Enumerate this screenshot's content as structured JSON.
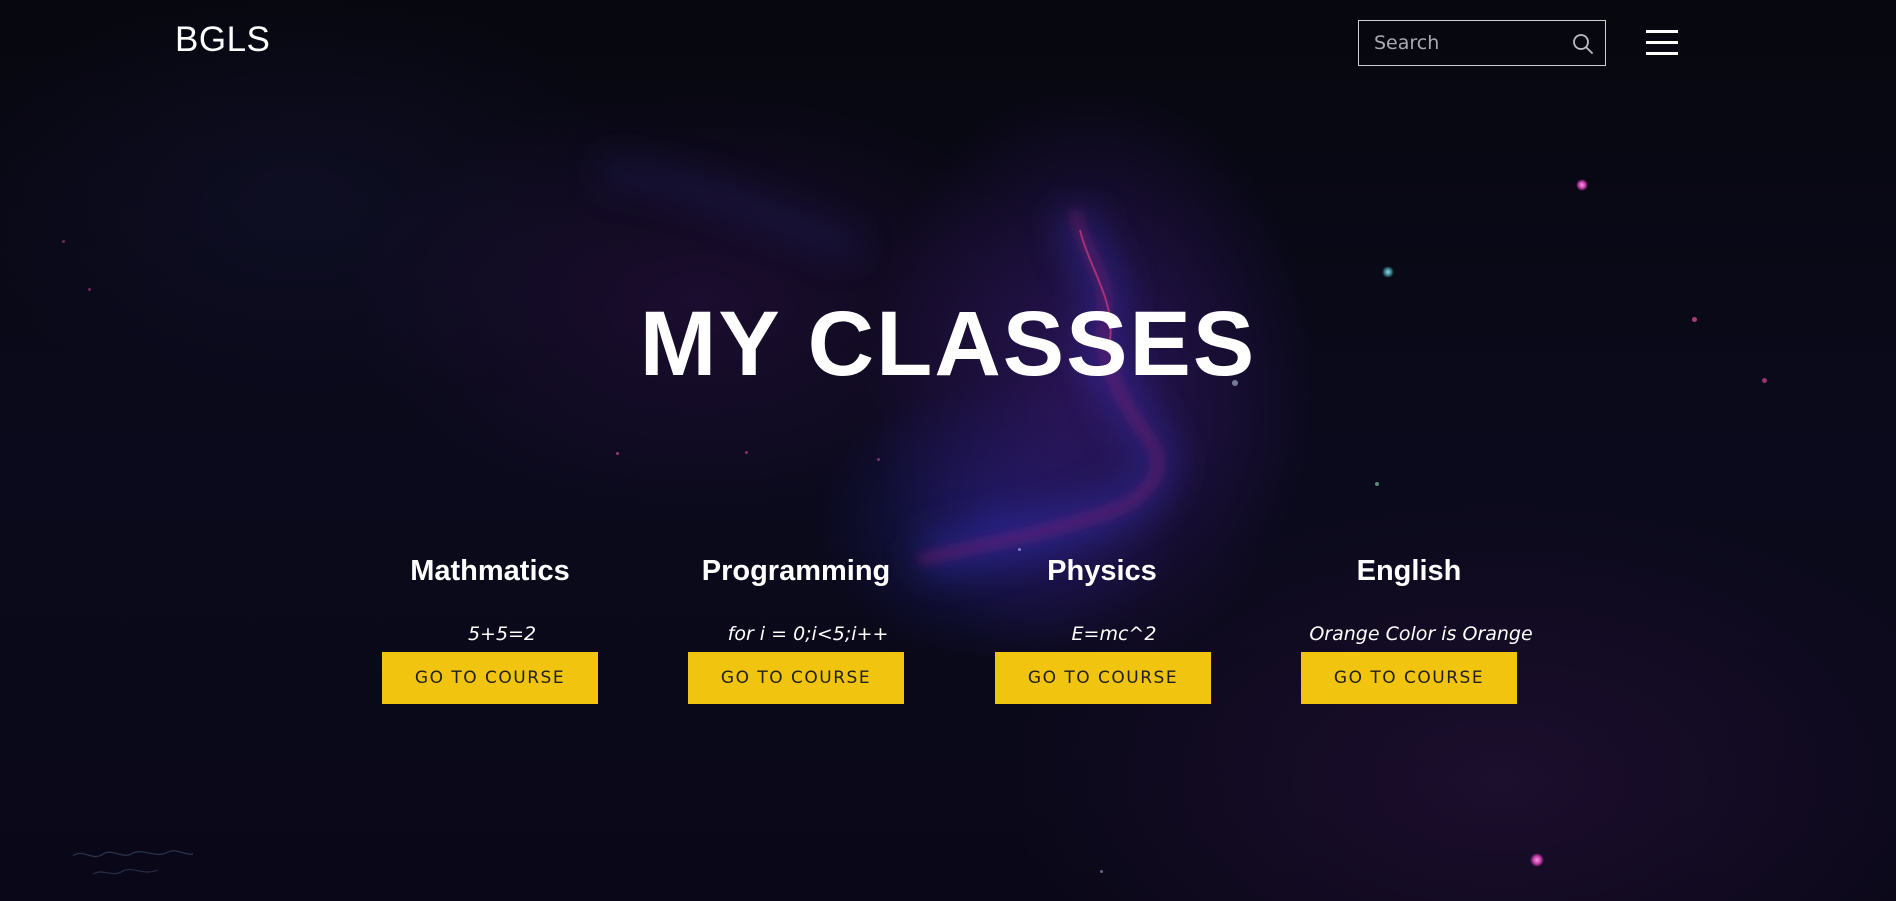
{
  "header": {
    "brand": "BGLS",
    "search": {
      "placeholder": "Search",
      "value": ""
    },
    "icons": {
      "search": "search-icon",
      "menu": "hamburger-menu-icon"
    }
  },
  "hero": {
    "title": "MY CLASSES"
  },
  "courses": [
    {
      "title": "Mathmatics",
      "description": "5+5=2",
      "button_label": "GO TO COURSE"
    },
    {
      "title": "Programming",
      "description": "for i = 0;i<5;i++",
      "button_label": "GO TO COURSE"
    },
    {
      "title": "Physics",
      "description": "E=mc^2",
      "button_label": "GO TO COURSE"
    },
    {
      "title": "English",
      "description": "Orange Color is Orange",
      "button_label": "GO TO COURSE"
    }
  ],
  "theme": {
    "accent": "#f1c40f",
    "text": "#ffffff",
    "background": "#0b0a1c",
    "nebula_pink": "#c2185b",
    "nebula_blue": "#2a2fb8"
  }
}
